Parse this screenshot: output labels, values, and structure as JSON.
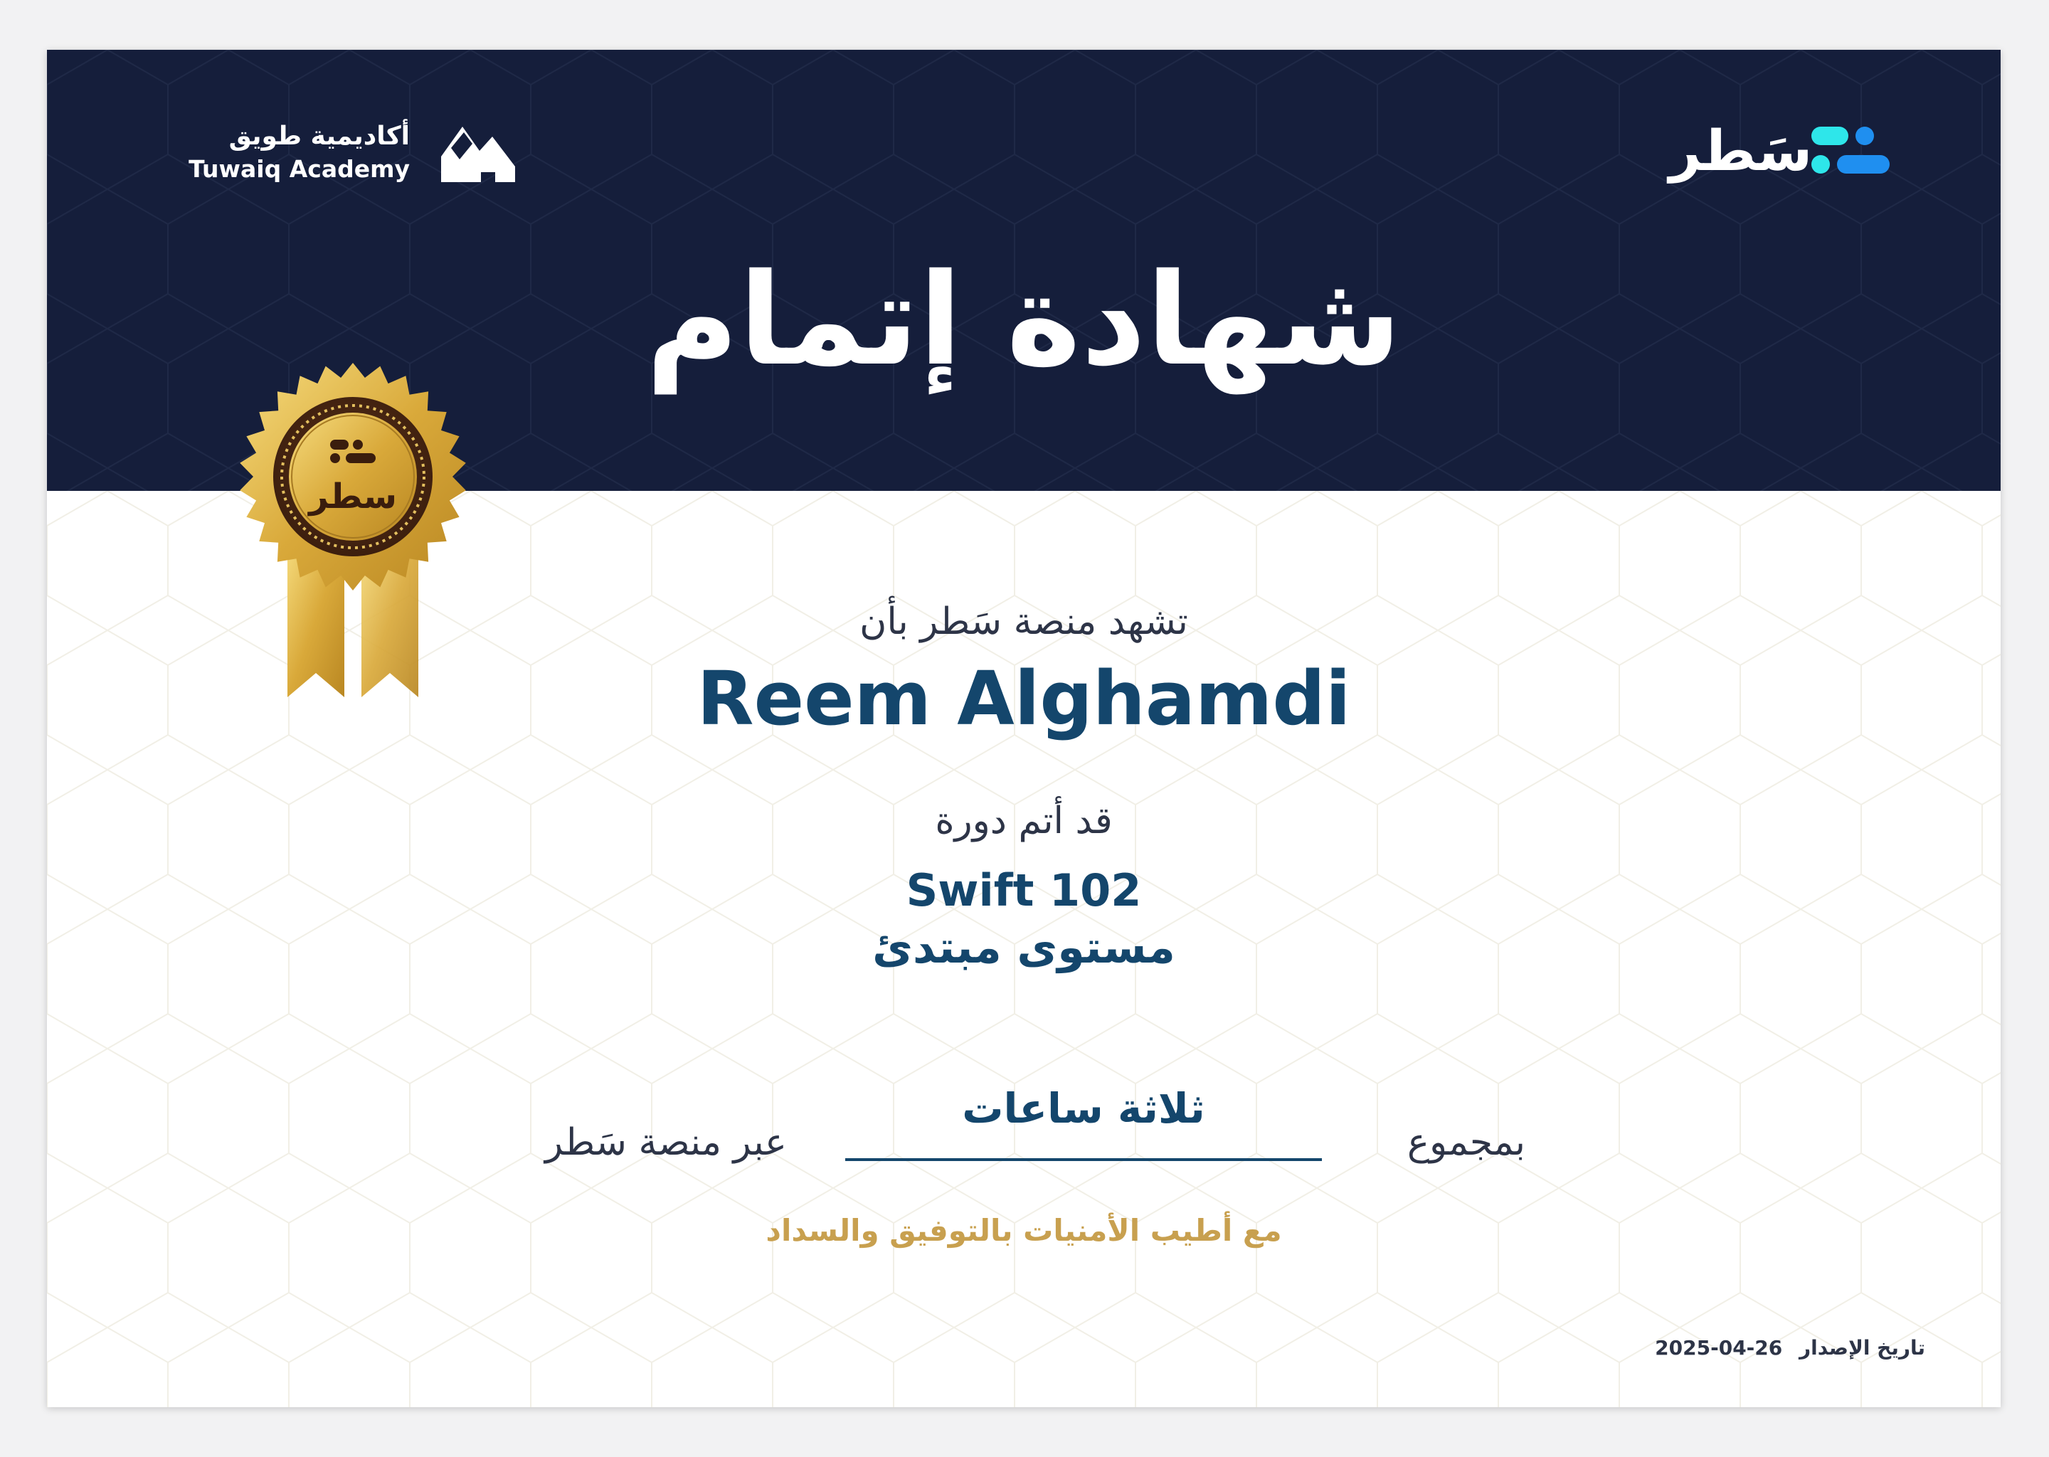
{
  "certificate": {
    "title": "شهادة إتمام",
    "lead_text": "تشهد منصة سَطر بأن",
    "recipient_name": "Reem Alghamdi",
    "completed_text": "قد أتم دورة",
    "course_name": "Swift 102",
    "course_level": "مستوى مبتدئ",
    "total_prefix": "بمجموع",
    "total_value": "ثلاثة ساعات",
    "total_suffix": "عبر منصة سَطر",
    "wishes": "مع أطيب الأمنيات بالتوفيق والسداد",
    "issue_label": "تاريخ الإصدار",
    "issue_date": "2025-04-26"
  },
  "logos": {
    "satr_wordmark": "سَطر",
    "tuwaiq_arabic": "أكاديمية طويق",
    "tuwaiq_english": "Tuwaiq Academy",
    "seal_text": "سطر"
  },
  "colors": {
    "header_navy": "#151e3b",
    "name_blue": "#14466c",
    "gold": "#c8a04f",
    "satr_cyan": "#2ee6ea",
    "satr_blue": "#1f8ff0"
  }
}
